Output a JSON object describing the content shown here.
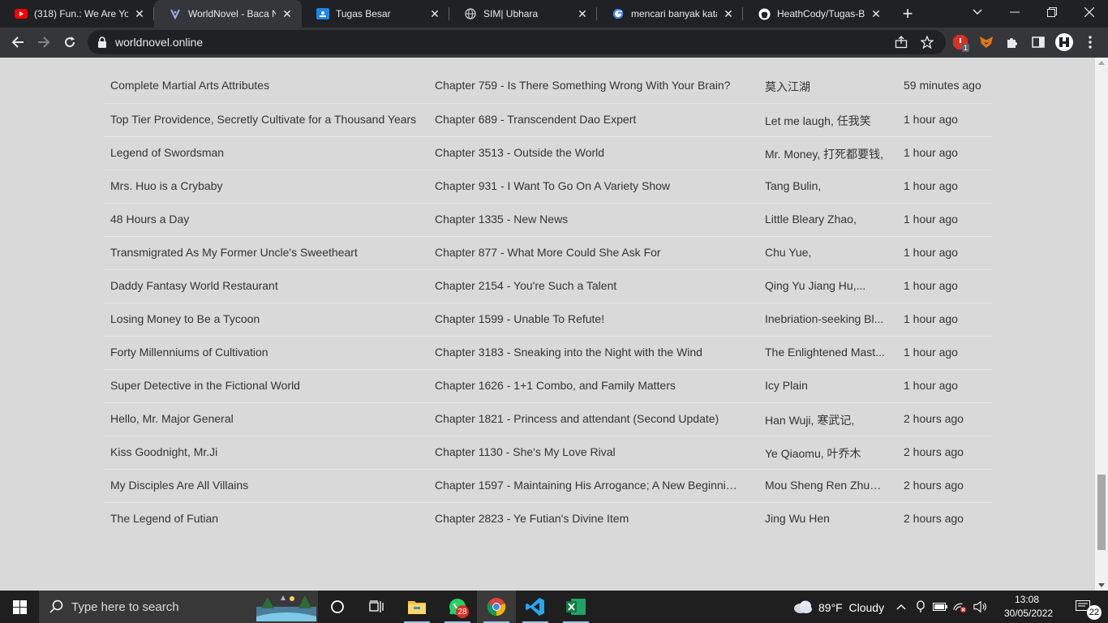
{
  "browser": {
    "tabs": [
      {
        "title": "(318) Fun.: We Are You",
        "favicon": "youtube-icon"
      },
      {
        "title": "WorldNovel - Baca No",
        "favicon": "worldnovel-icon"
      },
      {
        "title": "Tugas Besar",
        "favicon": "google-classroom-icon"
      },
      {
        "title": "SIM| Ubhara",
        "favicon": "globe-icon"
      },
      {
        "title": "mencari banyak kata y",
        "favicon": "google-icon"
      },
      {
        "title": "HeathCody/Tugas-Be",
        "favicon": "github-icon"
      }
    ],
    "active_tab": 1,
    "url": "worldnovel.online",
    "extension_badge": "1"
  },
  "novels": [
    {
      "title": "Complete Martial Arts Attributes",
      "chapter": "Chapter 759 - Is There Something Wrong With Your Brain?",
      "author": "莫入江湖",
      "time": "59 minutes ago"
    },
    {
      "title": "Top Tier Providence, Secretly Cultivate for a Thousand Years",
      "chapter": "Chapter 689 - Transcendent Dao Expert",
      "author": "Let me laugh, 任我笑",
      "time": "1 hour ago"
    },
    {
      "title": "Legend of Swordsman",
      "chapter": "Chapter 3513 - Outside the World",
      "author": "Mr. Money, 打死都要钱,",
      "time": "1 hour ago"
    },
    {
      "title": "Mrs. Huo is a Crybaby",
      "chapter": "Chapter 931 - I Want To Go On A Variety Show",
      "author": "Tang Bulin,",
      "time": "1 hour ago"
    },
    {
      "title": "48 Hours a Day",
      "chapter": "Chapter 1335 - New News",
      "author": "Little Bleary Zhao,",
      "time": "1 hour ago"
    },
    {
      "title": "Transmigrated As My Former Uncle's Sweetheart",
      "chapter": "Chapter 877 - What More Could She Ask For",
      "author": "Chu Yue,",
      "time": "1 hour ago"
    },
    {
      "title": "Daddy Fantasy World Restaurant",
      "chapter": "Chapter 2154 - You're Such a Talent",
      "author": "Qing Yu Jiang Hu,...",
      "time": "1 hour ago"
    },
    {
      "title": "Losing Money to Be a Tycoon",
      "chapter": "Chapter 1599 - Unable To Refute!",
      "author": "Inebriation-seeking Bl...",
      "time": "1 hour ago"
    },
    {
      "title": "Forty Millenniums of Cultivation",
      "chapter": "Chapter 3183 - Sneaking into the Night with the Wind",
      "author": "The Enlightened Mast...",
      "time": "1 hour ago"
    },
    {
      "title": "Super Detective in the Fictional World",
      "chapter": "Chapter 1626 - 1+1 Combo, and Family Matters",
      "author": "Icy Plain",
      "time": "1 hour ago"
    },
    {
      "title": "Hello, Mr. Major General",
      "chapter": "Chapter 1821 - Princess and attendant (Second Update)",
      "author": "Han Wuji, 寒武记,",
      "time": "2 hours ago"
    },
    {
      "title": "Kiss Goodnight, Mr.Ji",
      "chapter": "Chapter 1130 - She's My Love Rival",
      "author": "Ye Qiaomu, 叶乔木",
      "time": "2 hours ago"
    },
    {
      "title": "My Disciples Are All Villains",
      "chapter": "Chapter 1597 - Maintaining His Arrogance; A New Beginnin...",
      "author": "Mou Sheng Ren Zhuan...",
      "time": "2 hours ago"
    },
    {
      "title": "The Legend of Futian",
      "chapter": "Chapter 2823 - Ye Futian's Divine Item",
      "author": "Jing Wu Hen",
      "time": "2 hours ago"
    }
  ],
  "taskbar": {
    "search_placeholder": "Type here to search",
    "whatsapp_badge": "28",
    "weather": "89°F  Cloudy",
    "time": "13:08",
    "date": "30/05/2022",
    "notification_count": "22"
  },
  "colors": {
    "tab_bg": "#202124",
    "toolbar_bg": "#35363a",
    "page_bg": "#d9d9d9",
    "row_text": "#333333",
    "taskbar_bg": "#1f1f1f"
  }
}
